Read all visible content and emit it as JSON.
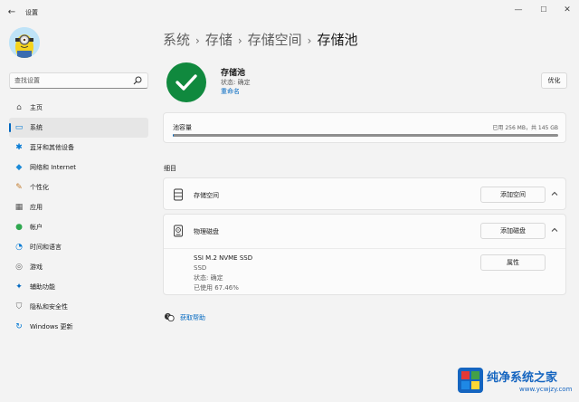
{
  "window": {
    "title": "设置",
    "back_icon": "back-arrow-icon",
    "minimize_glyph": "—",
    "maximize_glyph": "☐",
    "close_glyph": "✕"
  },
  "sidebar": {
    "search_placeholder": "查找设置",
    "items": [
      {
        "label": "主页",
        "icon": "home-icon",
        "glyph": "⌂",
        "color": "#555555"
      },
      {
        "label": "系统",
        "icon": "system-icon",
        "glyph": "▭",
        "color": "#0078d4",
        "active": true
      },
      {
        "label": "蓝牙和其他设备",
        "icon": "bluetooth-icon",
        "glyph": "✱",
        "color": "#0078d4"
      },
      {
        "label": "网络和 Internet",
        "icon": "network-icon",
        "glyph": "◆",
        "color": "#1b8ad8"
      },
      {
        "label": "个性化",
        "icon": "brush-icon",
        "glyph": "✎",
        "color": "#c27a2c"
      },
      {
        "label": "应用",
        "icon": "apps-icon",
        "glyph": "▦",
        "color": "#555555"
      },
      {
        "label": "帐户",
        "icon": "account-icon",
        "glyph": "●",
        "color": "#2fa84f"
      },
      {
        "label": "时间和语言",
        "icon": "globe-clock-icon",
        "glyph": "◔",
        "color": "#0078d4"
      },
      {
        "label": "游戏",
        "icon": "game-controller-icon",
        "glyph": "◎",
        "color": "#666666"
      },
      {
        "label": "辅助功能",
        "icon": "accessibility-icon",
        "glyph": "✦",
        "color": "#0067c0"
      },
      {
        "label": "隐私和安全性",
        "icon": "shield-icon",
        "glyph": "⛉",
        "color": "#666666"
      },
      {
        "label": "Windows 更新",
        "icon": "update-icon",
        "glyph": "↻",
        "color": "#0078d4"
      }
    ]
  },
  "breadcrumb": [
    "系统",
    "存储",
    "存储空间",
    "存储池"
  ],
  "pool": {
    "name": "存储池",
    "state": "状态: 确定",
    "rename": "重命名",
    "optimize": "优化",
    "status_color": "#10893e"
  },
  "capacity": {
    "label": "池容量",
    "text": "已用 256 MB，共 145 GB",
    "used_fraction": 0.0018
  },
  "details": {
    "title": "细目",
    "spaces": {
      "label": "存储空间",
      "button": "添加空间"
    },
    "disks": {
      "label": "物理磁盘",
      "button": "添加磁盘"
    },
    "disk": {
      "name": "SSI M.2 NVME SSD",
      "type": "SSD",
      "state": "状态: 确定",
      "used": "已使用 67.46%",
      "button": "属性"
    }
  },
  "help": {
    "label": "获取帮助"
  },
  "watermark": {
    "title": "纯净系统之家",
    "url": "www.ycwjzy.com"
  },
  "colors": {
    "accent": "#0067c0",
    "success": "#10893e"
  }
}
